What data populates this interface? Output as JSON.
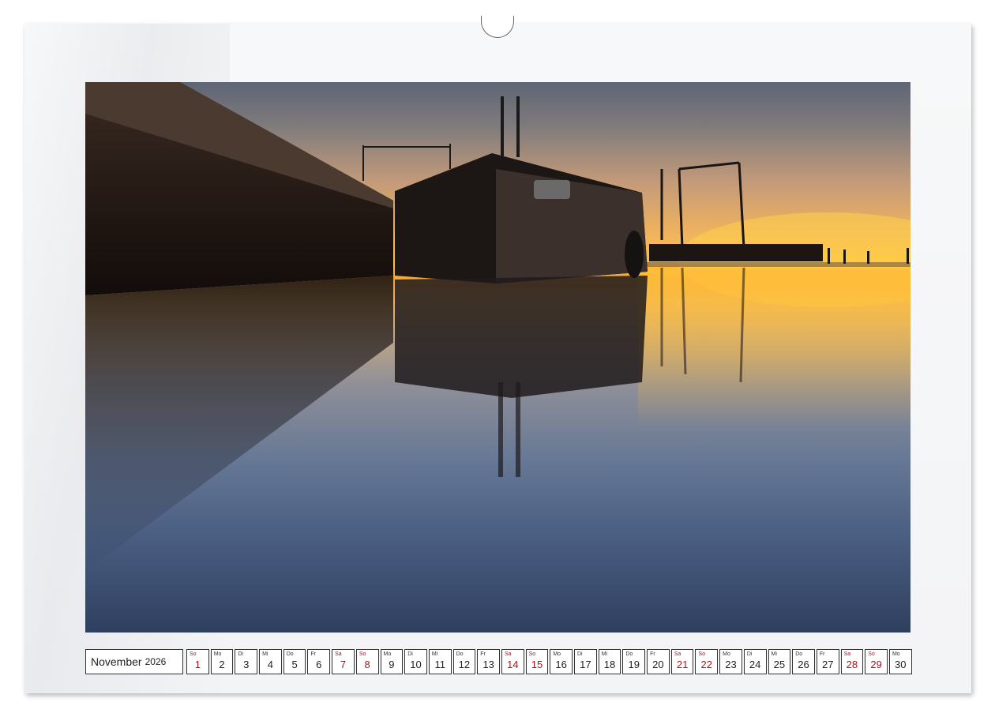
{
  "calendar": {
    "month": "November",
    "year": "2026",
    "days": [
      {
        "wd": "So",
        "num": "1",
        "weekend": true
      },
      {
        "wd": "Mo",
        "num": "2",
        "weekend": false
      },
      {
        "wd": "Di",
        "num": "3",
        "weekend": false
      },
      {
        "wd": "Mi",
        "num": "4",
        "weekend": false
      },
      {
        "wd": "Do",
        "num": "5",
        "weekend": false
      },
      {
        "wd": "Fr",
        "num": "6",
        "weekend": false
      },
      {
        "wd": "Sa",
        "num": "7",
        "weekend": true
      },
      {
        "wd": "So",
        "num": "8",
        "weekend": true
      },
      {
        "wd": "Mo",
        "num": "9",
        "weekend": false
      },
      {
        "wd": "Di",
        "num": "10",
        "weekend": false
      },
      {
        "wd": "Mi",
        "num": "11",
        "weekend": false
      },
      {
        "wd": "Do",
        "num": "12",
        "weekend": false
      },
      {
        "wd": "Fr",
        "num": "13",
        "weekend": false
      },
      {
        "wd": "Sa",
        "num": "14",
        "weekend": true
      },
      {
        "wd": "So",
        "num": "15",
        "weekend": true
      },
      {
        "wd": "Mo",
        "num": "16",
        "weekend": false
      },
      {
        "wd": "Di",
        "num": "17",
        "weekend": false
      },
      {
        "wd": "Mi",
        "num": "18",
        "weekend": false
      },
      {
        "wd": "Do",
        "num": "19",
        "weekend": false
      },
      {
        "wd": "Fr",
        "num": "20",
        "weekend": false
      },
      {
        "wd": "Sa",
        "num": "21",
        "weekend": true
      },
      {
        "wd": "So",
        "num": "22",
        "weekend": true
      },
      {
        "wd": "Mo",
        "num": "23",
        "weekend": false
      },
      {
        "wd": "Di",
        "num": "24",
        "weekend": false
      },
      {
        "wd": "Mi",
        "num": "25",
        "weekend": false
      },
      {
        "wd": "Do",
        "num": "26",
        "weekend": false
      },
      {
        "wd": "Fr",
        "num": "27",
        "weekend": false
      },
      {
        "wd": "Sa",
        "num": "28",
        "weekend": true
      },
      {
        "wd": "So",
        "num": "29",
        "weekend": true
      },
      {
        "wd": "Mo",
        "num": "30",
        "weekend": false
      }
    ]
  },
  "colors": {
    "weekend_text": "#b3121b",
    "sunset_glow": "#ffc23a",
    "water_deep": "#2f3f5e"
  }
}
